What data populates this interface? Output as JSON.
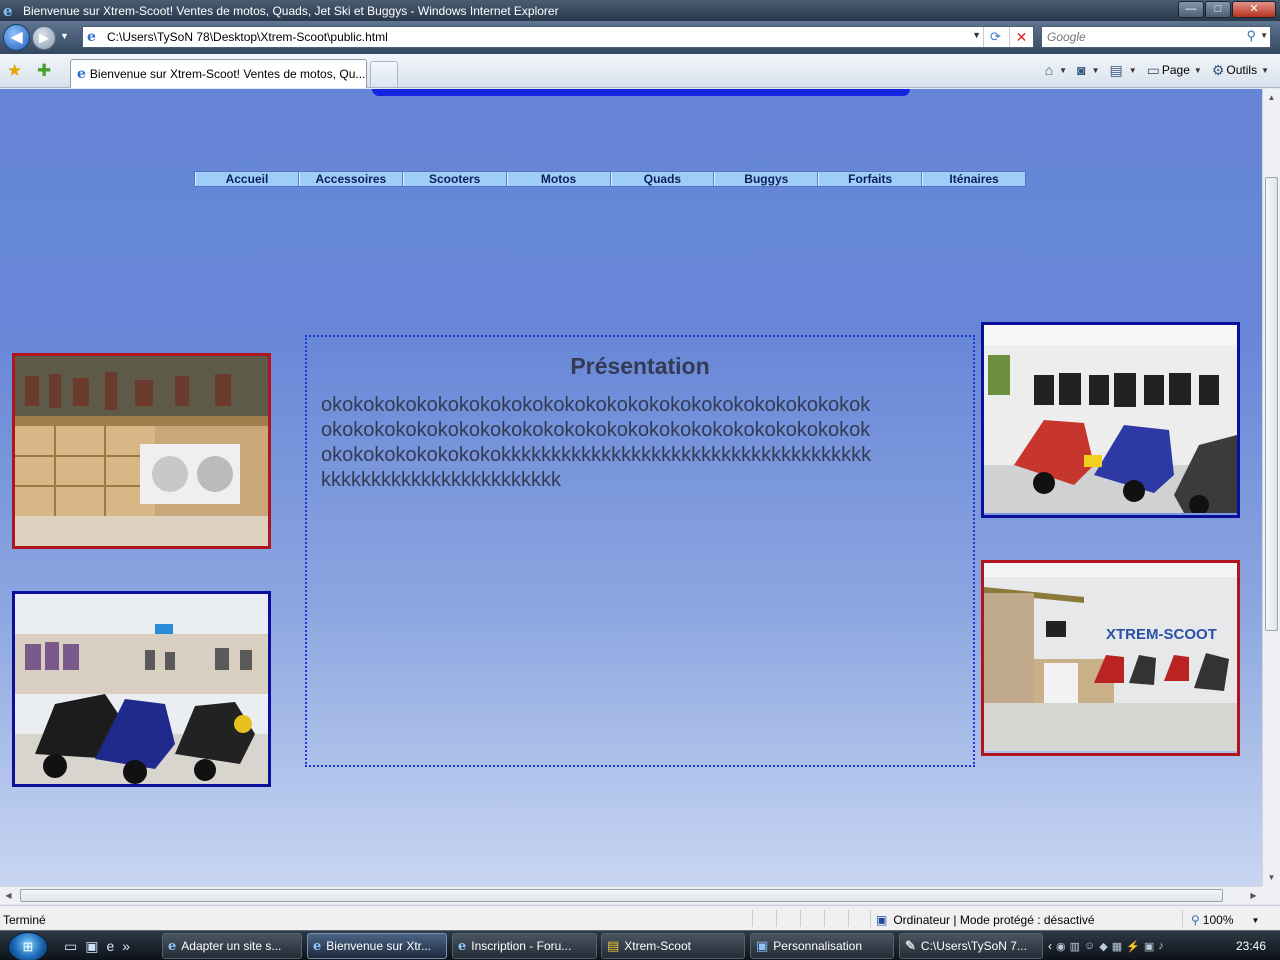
{
  "window": {
    "title": "Bienvenue sur Xtrem-Scoot! Ventes de motos, Quads, Jet Ski et Buggys - Windows Internet Explorer",
    "min": "—",
    "max": "□",
    "close": "✕"
  },
  "nav": {
    "url": "C:\\Users\\TySoN 78\\Desktop\\Xtrem-Scoot\\public.html",
    "search_placeholder": "Google"
  },
  "tabs": [
    {
      "label": "Bienvenue sur Xtrem-Scoot! Ventes de motos, Qu..."
    }
  ],
  "commands": {
    "page": "Page",
    "tools": "Outils"
  },
  "site": {
    "menu": [
      "Accueil",
      "Accessoires",
      "Scooters",
      "Motos",
      "Quads",
      "Buggys",
      "Forfaits",
      "Iténaires"
    ],
    "heading": "Présentation",
    "body": "okokokokokokokokokokokokokokokokokokokokokokokokokokokokokokokokokokokokokokokokokokokokokokokokokokokokokokokokokokokokokkkkkkkkkkkkkkkkkkkkkkkkkkkkkkkkkkkkkkkkkkkkkkkkkkkkkkkkkkkkk",
    "logo_text": "XTREM-SCOOT"
  },
  "status": {
    "text": "Terminé",
    "zone": "Ordinateur | Mode protégé : désactivé",
    "zoom": "100%"
  },
  "taskbar": {
    "items": [
      {
        "label": "Adapter un site s..."
      },
      {
        "label": "Bienvenue sur Xtr..."
      },
      {
        "label": "Inscription - Foru..."
      },
      {
        "label": "Xtrem-Scoot"
      },
      {
        "label": "Personnalisation"
      },
      {
        "label": "C:\\Users\\TySoN 7..."
      }
    ],
    "clock": "23:46"
  },
  "colors": {
    "page_bg_top": "#6685d6",
    "menu_bg": "#9ecdf8",
    "red_frame": "#b0141c",
    "blue_frame": "#0c0e9c"
  }
}
